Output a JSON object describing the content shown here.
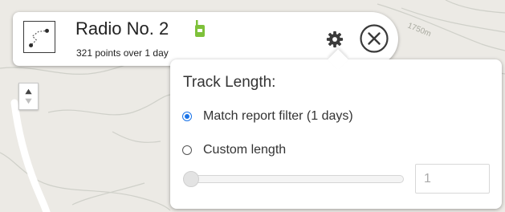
{
  "map": {
    "contour_label": "1750m",
    "route_color": "#ffffff",
    "contour_color": "#cfd0c9",
    "background_color": "#eceae5"
  },
  "track_card": {
    "title": "Radio No. 2",
    "subtitle": "321 points over 1 day",
    "track_icon": "route-path-icon",
    "device_icon": "radio-device-icon",
    "device_icon_color": "#7ec13a",
    "settings_icon": "gear-icon",
    "close_icon": "close-circle-icon"
  },
  "map_controls": {
    "zoom_icon": "zoom-arrows-icon"
  },
  "track_length_popup": {
    "heading": "Track Length:",
    "options": [
      {
        "label": "Match report filter (1 days)",
        "selected": true
      },
      {
        "label": "Custom length",
        "selected": false
      }
    ],
    "slider_value": 1,
    "custom_length_value": "1",
    "accent_color": "#1a73e8"
  }
}
